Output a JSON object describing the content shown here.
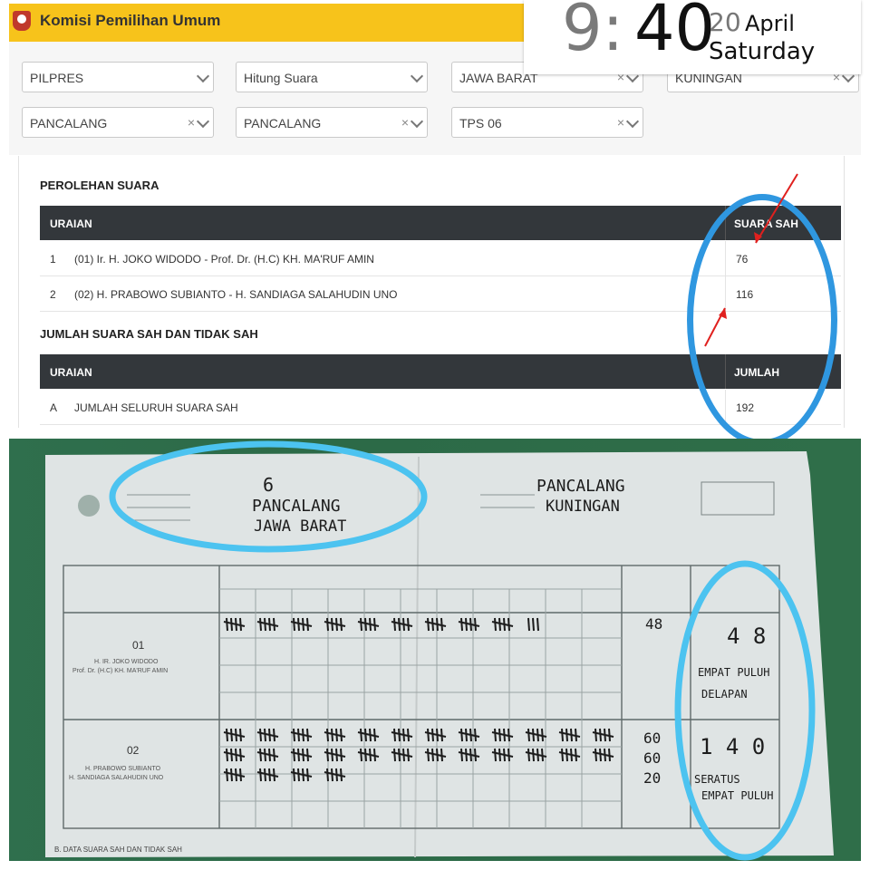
{
  "header": {
    "title": "Komisi Pemilihan Umum"
  },
  "clock": {
    "hour": "9",
    "colon": ":",
    "minute": "40",
    "day": "20",
    "month": "April",
    "weekday": "Saturday"
  },
  "filters": [
    {
      "value": "PILPRES",
      "clear": ""
    },
    {
      "value": "Hitung Suara",
      "clear": ""
    },
    {
      "value": "JAWA BARAT",
      "clear": "×"
    },
    {
      "value": "KUNINGAN",
      "clear": "×"
    },
    {
      "value": "PANCALANG",
      "clear": "×"
    },
    {
      "value": "PANCALANG",
      "clear": "×"
    },
    {
      "value": "TPS 06",
      "clear": "×"
    }
  ],
  "perolehan": {
    "heading": "PEROLEHAN SUARA",
    "col_uraian": "URAIAN",
    "col_suara": "SUARA SAH",
    "rows": [
      {
        "no": "1",
        "name": "(01) Ir. H. JOKO WIDODO - Prof. Dr. (H.C) KH. MA'RUF AMIN",
        "votes": "76"
      },
      {
        "no": "2",
        "name": "(02) H. PRABOWO SUBIANTO - H. SANDIAGA SALAHUDIN UNO",
        "votes": "116"
      }
    ]
  },
  "jumlah": {
    "heading": "JUMLAH SUARA SAH DAN TIDAK SAH",
    "col_uraian": "URAIAN",
    "col_jumlah": "JUMLAH",
    "rows": [
      {
        "no": "A",
        "name": "JUMLAH SELURUH SUARA SAH",
        "value": "192"
      }
    ]
  },
  "form": {
    "hw_tps": "6",
    "hw_desa": "PANCALANG",
    "hw_prov": "JAWA BARAT",
    "hw_kec": "PANCALANG",
    "hw_kab": "KUNINGAN",
    "candidate1_no": "01",
    "candidate1_name": "H. IR. JOKO WIDODO",
    "candidate1_name2": "Prof. Dr. (H.C) KH. MA'RUF AMIN",
    "candidate1_tally": "48",
    "candidate1_total": "4 8",
    "candidate1_words1": "EMPAT PULUH",
    "candidate1_words2": "DELAPAN",
    "candidate2_no": "02",
    "candidate2_name": "H. PRABOWO SUBIANTO",
    "candidate2_name2": "H. SANDIAGA SALAHUDIN UNO",
    "candidate2_tally1": "60",
    "candidate2_tally2": "60",
    "candidate2_tally3": "20",
    "candidate2_total": "1 4 0",
    "candidate2_words1": "SERATUS",
    "candidate2_words2": "EMPAT PULUH",
    "footer": "B. DATA SUARA SAH DAN TIDAK SAH"
  },
  "colors": {
    "accent": "#f7c31b",
    "header_dark": "#33373b",
    "circle": "#2f97e0",
    "arrow": "#e0201e"
  }
}
